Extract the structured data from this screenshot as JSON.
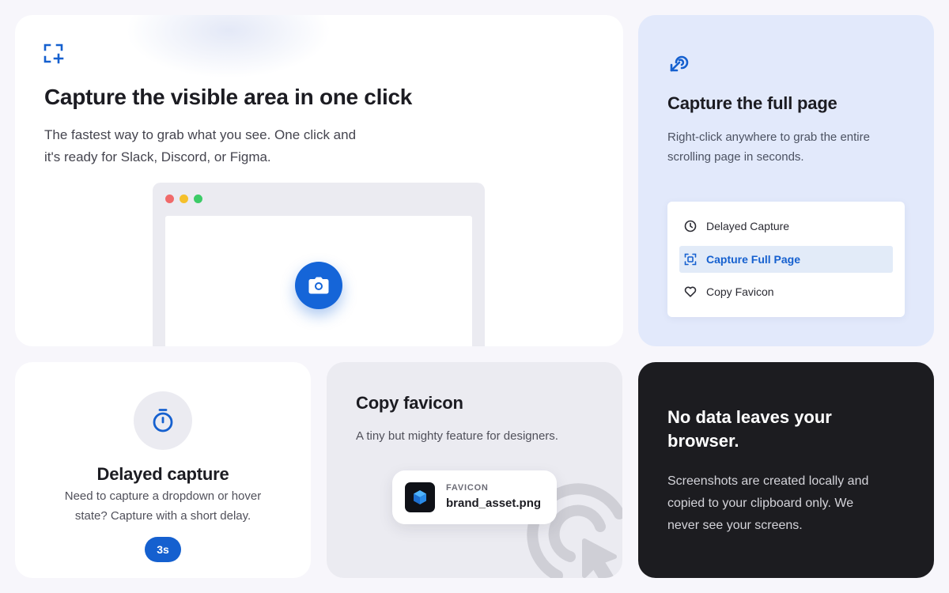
{
  "visible_card": {
    "icon": "capture-area-icon",
    "title": "Capture the visible area in one click",
    "description_line1": "The fastest way to grab what you see. One click and",
    "description_line2": "it's ready for Slack, Discord, or Figma.",
    "browser_dots": [
      "#f06a6a",
      "#f5c02b",
      "#3ccb67"
    ],
    "camera_icon": "camera-icon",
    "accent": "#1565d8"
  },
  "full_page_card": {
    "icon": "cursor-click-icon",
    "title": "Capture the full page",
    "description_line1": "Right-click anywhere to grab the entire",
    "description_line2": "scrolling page in seconds.",
    "menu": [
      {
        "icon": "clock-icon",
        "label": "Delayed Capture",
        "active": false
      },
      {
        "icon": "scan-icon",
        "label": "Capture Full Page",
        "active": true
      },
      {
        "icon": "heart-icon",
        "label": "Copy Favicon",
        "active": false
      }
    ]
  },
  "delay_card": {
    "icon": "stopwatch-icon",
    "title": "Delayed capture",
    "description_line1": "Need to capture a dropdown or hover",
    "description_line2": "state? Capture with a short delay.",
    "delay_label": "3s"
  },
  "favicon_card": {
    "title": "Copy favicon",
    "description": "A tiny but mighty feature for designers.",
    "chip_label": "FAVICON",
    "chip_file": "brand_asset.png",
    "chip_icon": "cube-icon",
    "decor_icon": "click-target-icon"
  },
  "privacy_card": {
    "title_line1": "No data leaves your",
    "title_line2": "browser.",
    "description_line1": "Screenshots are created locally and",
    "description_line2": "copied to your clipboard only. We",
    "description_line3": "never see your screens."
  }
}
